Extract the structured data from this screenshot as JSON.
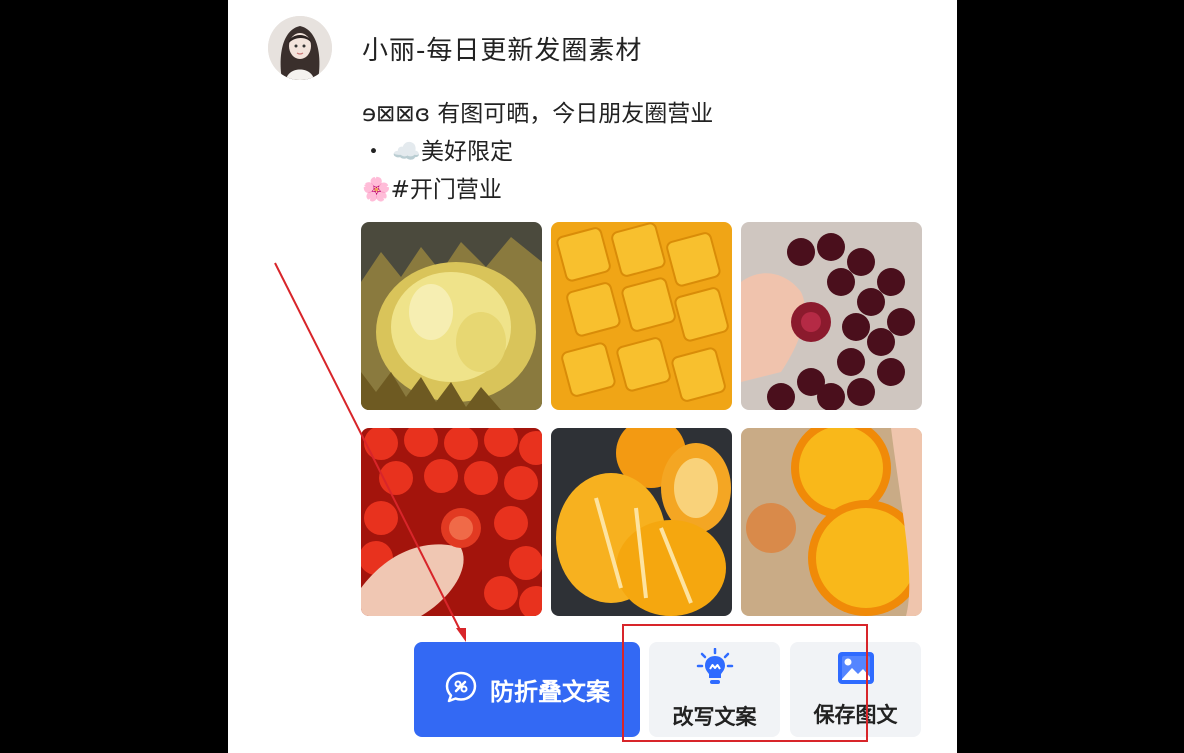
{
  "post": {
    "author": "小丽-每日更新发圈素材",
    "lines": [
      "ɘ⊠⊠ɞ 有图可晒，今日朋友圈营业",
      "・ ☁️美好限定",
      "🌸#开门营业"
    ]
  },
  "photos": [
    {
      "subject": "durian",
      "icon": "durian-photo"
    },
    {
      "subject": "mango",
      "icon": "mango-photo"
    },
    {
      "subject": "cherries",
      "icon": "cherry-photo"
    },
    {
      "subject": "cherry tomatoes",
      "icon": "tomato-photo"
    },
    {
      "subject": "peeled oranges",
      "icon": "tangerine-photo"
    },
    {
      "subject": "orange halves",
      "icon": "orange-photo"
    }
  ],
  "actions": {
    "anti_fold": {
      "label": "防折叠文案",
      "icon": "chat-bubble-icon"
    },
    "rewrite": {
      "label": "改写文案",
      "icon": "lightbulb-icon"
    },
    "save": {
      "label": "保存图文",
      "icon": "image-icon"
    }
  },
  "colors": {
    "primary_button": "#3369f4",
    "annotation": "#d8252a",
    "secondary_button": "#f1f3f6"
  }
}
